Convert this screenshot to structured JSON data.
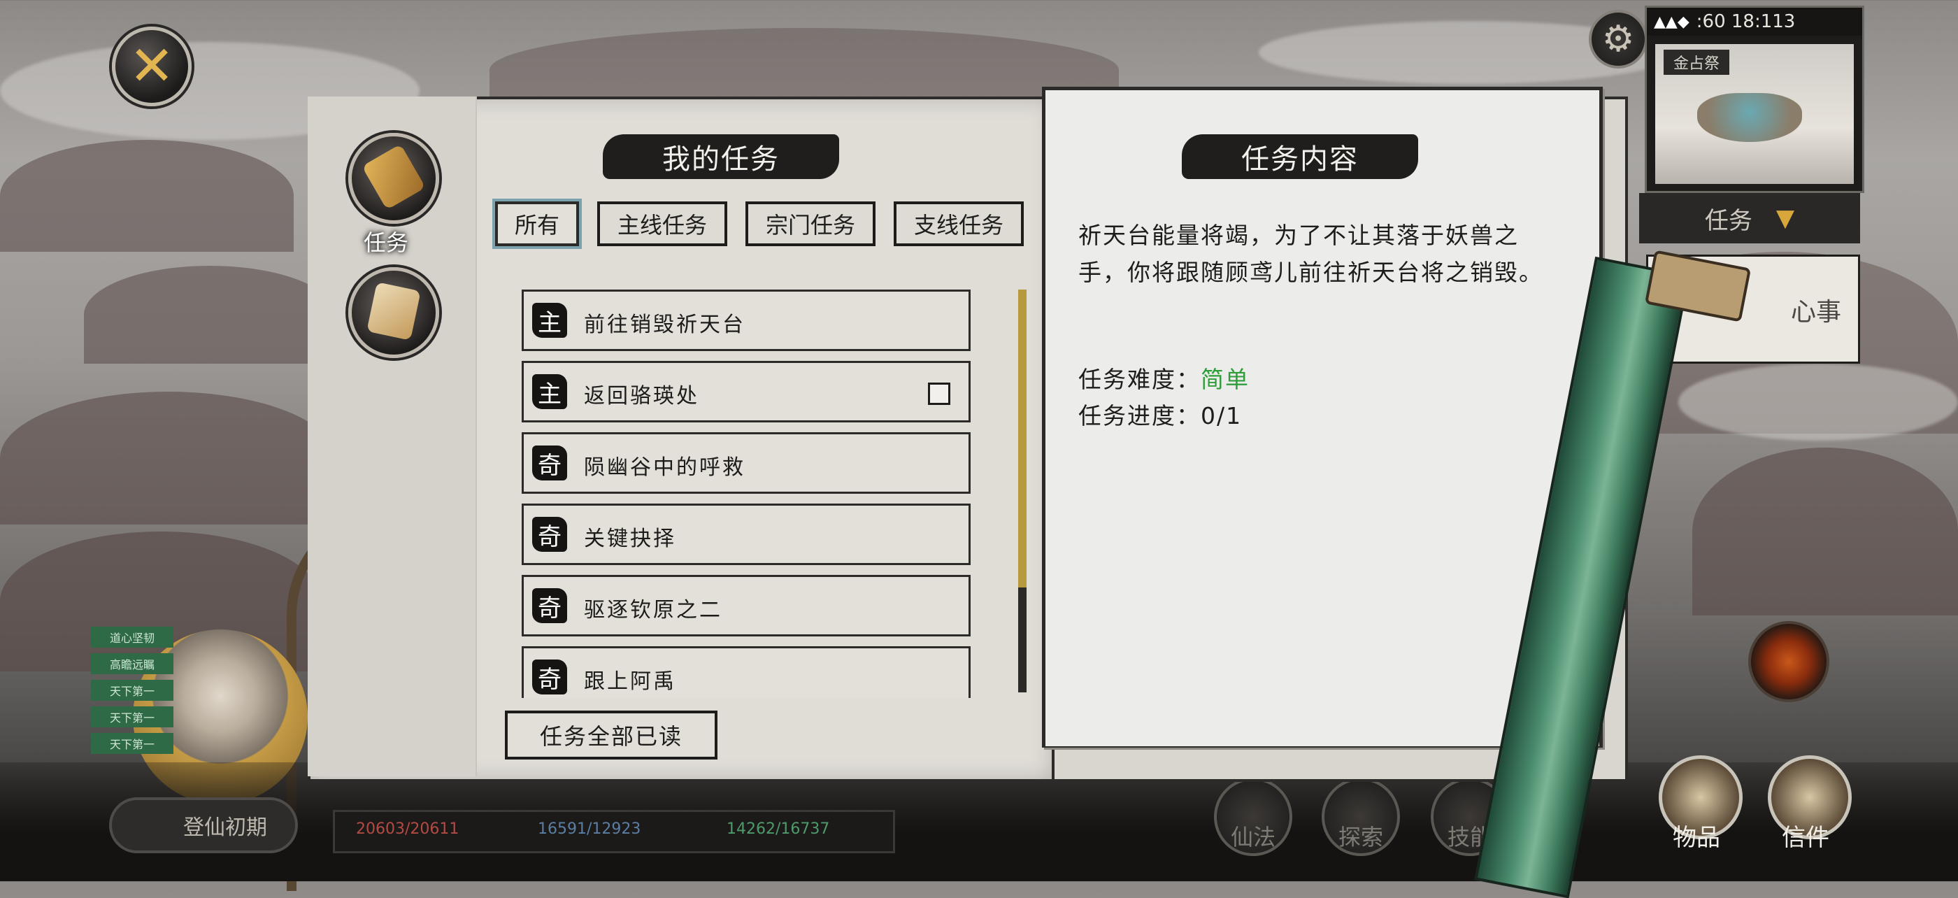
{
  "close_glyph": "✕",
  "tabs": [
    {
      "label": "任务"
    },
    {
      "label": ""
    }
  ],
  "quest_panel": {
    "title": "我的任务",
    "filters": [
      "所有",
      "主线任务",
      "宗门任务",
      "支线任务"
    ],
    "active_filter": "所有",
    "quests": [
      {
        "badge": "主",
        "title": "前往销毁祈天台",
        "checkbox": false
      },
      {
        "badge": "主",
        "title": "返回骆瑛处",
        "checkbox": true
      },
      {
        "badge": "奇",
        "title": "陨幽谷中的呼救",
        "checkbox": false
      },
      {
        "badge": "奇",
        "title": "关键抉择",
        "checkbox": false
      },
      {
        "badge": "奇",
        "title": "驱逐钦原之二",
        "checkbox": false
      },
      {
        "badge": "奇",
        "title": "跟上阿禹",
        "checkbox": false
      }
    ],
    "scroll_position": 0.74,
    "read_all_label": "任务全部已读"
  },
  "detail_panel": {
    "title": "任务内容",
    "description": "祈天台能量将竭，为了不让其落于妖兽之手，你将跟随顾鸢儿前往祈天台将之销毁。",
    "difficulty_label": "任务难度：",
    "difficulty_value": "简单",
    "difficulty_color": "#2f9e3a",
    "progress_label": "任务进度：",
    "progress_value": "0/1"
  },
  "hud": {
    "status_time": ":60 18:113",
    "minimap_label": "金占祭",
    "quest_dropdown_label": "任务",
    "dropdown_arrow": "▼",
    "side_quest_text": "心事",
    "realm_label": "登仙初期",
    "stat_hp": "20603/20611",
    "stat_mp": "16591/12923",
    "stat_exp": "14262/16737",
    "menu": [
      {
        "label": "仙法"
      },
      {
        "label": "探索"
      },
      {
        "label": "技能"
      }
    ],
    "items": [
      {
        "label": "物品"
      },
      {
        "label": "信件"
      }
    ],
    "tags": [
      "道心坚韧",
      "高瞻远瞩",
      "天下第一",
      "天下第一",
      "天下第一"
    ]
  }
}
